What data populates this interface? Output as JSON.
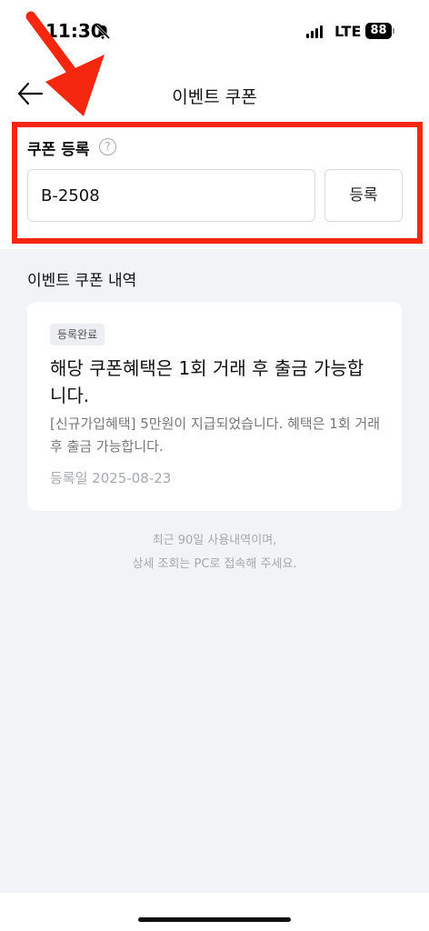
{
  "status_bar": {
    "time": "11:30",
    "network": "LTE",
    "battery": "88"
  },
  "header": {
    "title": "이벤트 쿠폰",
    "back_icon": "arrow-left-icon"
  },
  "register": {
    "label": "쿠폰 등록",
    "help_icon_text": "?",
    "input_value": "B-2508",
    "button_label": "등록"
  },
  "history": {
    "title": "이벤트 쿠폰 내역",
    "items": [
      {
        "status": "등록완료",
        "title": "해당 쿠폰혜택은 1회 거래 후 출금 가능합니다.",
        "description": "[신규가입혜택] 5만원이 지급되었습니다. 혜택은 1회 거래 후 출금 가능합니다.",
        "date": "등록일 2025-08-23"
      }
    ]
  },
  "footer": {
    "line1": "최근 90일 사용내역이며,",
    "line2": "상세 조회는 PC로 접속해 주세요."
  },
  "colors": {
    "annotation_red": "#f5280f",
    "background": "#f2f3f6"
  }
}
